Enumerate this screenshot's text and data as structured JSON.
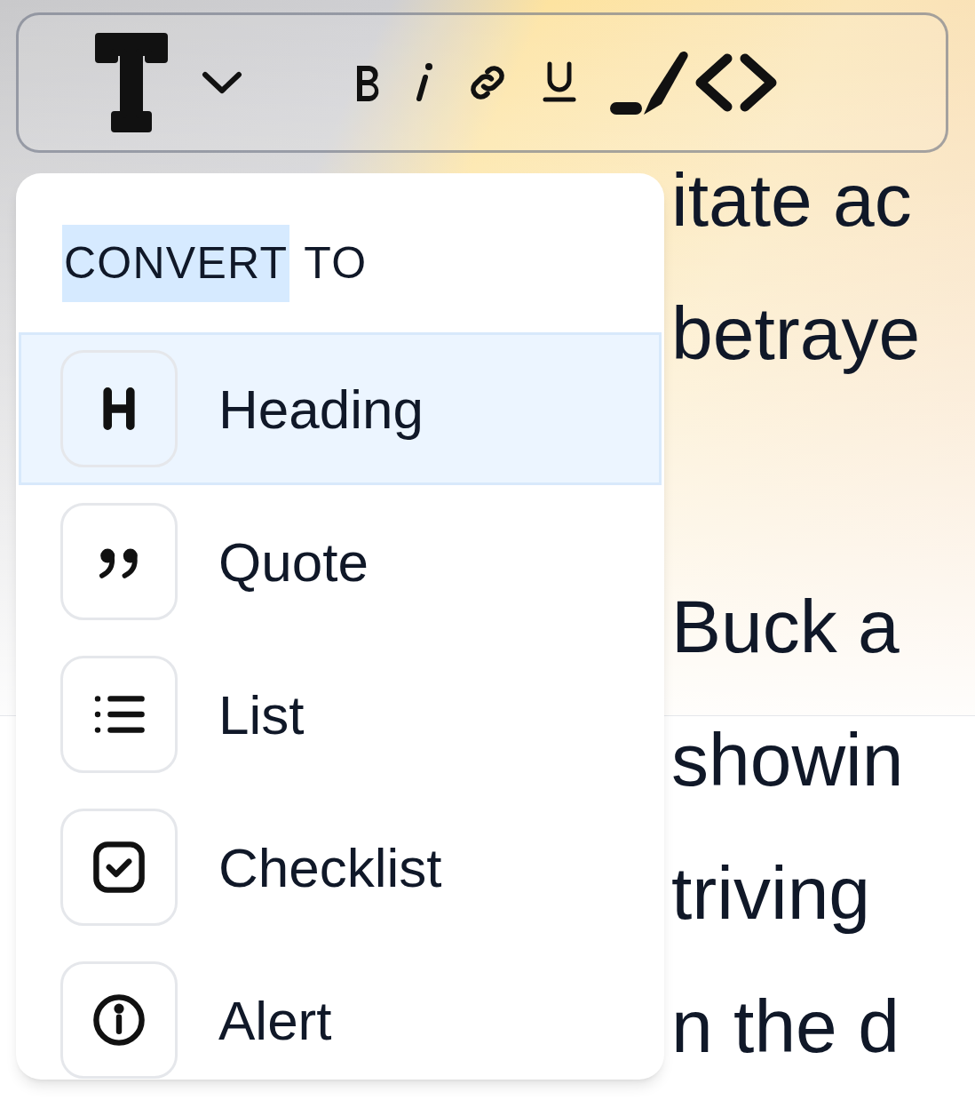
{
  "body_lines": [
    {
      "text": "itate ac"
    },
    {
      "text": "betraye"
    },
    {
      "text": "Buck a"
    },
    {
      "text": "showin"
    },
    {
      "text": "triving"
    },
    {
      "text": "n the d"
    }
  ],
  "toolbar": {
    "items": [
      {
        "kind": "text-style"
      },
      {
        "kind": "caret"
      },
      {
        "kind": "bold"
      },
      {
        "kind": "italic"
      },
      {
        "kind": "link"
      },
      {
        "kind": "underline"
      },
      {
        "kind": "highlight"
      },
      {
        "kind": "code"
      }
    ]
  },
  "menu": {
    "title_words": [
      {
        "text": "CONVERT",
        "selected": true
      },
      {
        "text": "TO",
        "selected": false
      }
    ],
    "items": [
      {
        "kind": "heading",
        "label": "Heading",
        "selected": true
      },
      {
        "kind": "quote",
        "label": "Quote",
        "selected": false
      },
      {
        "kind": "list",
        "label": "List",
        "selected": false
      },
      {
        "kind": "checklist",
        "label": "Checklist",
        "selected": false
      },
      {
        "kind": "alert",
        "label": "Alert",
        "selected": false
      }
    ]
  }
}
